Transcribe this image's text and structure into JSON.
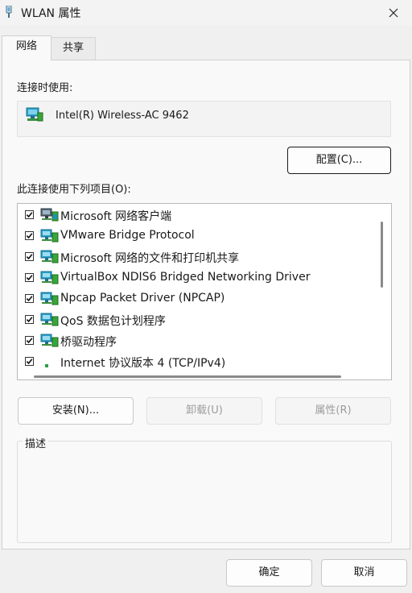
{
  "window": {
    "title": "WLAN 属性",
    "title_icon": "network-adapter-icon",
    "close_icon": "close-icon"
  },
  "tabs": [
    {
      "label": "网络",
      "selected": true
    },
    {
      "label": "共享",
      "selected": false
    }
  ],
  "connect_using": {
    "label": "连接时使用:",
    "adapter_name": "Intel(R) Wireless-AC 9462",
    "adapter_icon": "network-adapter-icon",
    "configure_button": "配置(C)..."
  },
  "items_label": "此连接使用下列项目(O):",
  "items": [
    {
      "label": "Microsoft 网络客户端",
      "checked": true,
      "icon": "network-client-icon"
    },
    {
      "label": "VMware Bridge Protocol",
      "checked": true,
      "icon": "network-service-icon"
    },
    {
      "label": "Microsoft 网络的文件和打印机共享",
      "checked": true,
      "icon": "network-service-icon"
    },
    {
      "label": "VirtualBox NDIS6 Bridged Networking Driver",
      "checked": true,
      "icon": "network-service-icon"
    },
    {
      "label": "Npcap Packet Driver (NPCAP)",
      "checked": true,
      "icon": "network-service-icon"
    },
    {
      "label": "QoS 数据包计划程序",
      "checked": true,
      "icon": "network-service-icon"
    },
    {
      "label": "桥驱动程序",
      "checked": true,
      "icon": "network-service-icon"
    },
    {
      "label": "Internet 协议版本 4 (TCP/IPv4)",
      "checked": true,
      "icon": "protocol-icon"
    }
  ],
  "action_buttons": {
    "install": "安装(N)...",
    "uninstall": "卸载(U)",
    "properties": "属性(R)"
  },
  "description": {
    "label": "描述",
    "text": ""
  },
  "footer": {
    "ok": "确定",
    "cancel": "取消"
  },
  "colors": {
    "window_bg": "#f0f0f0",
    "panel_bg": "#f9f9f9",
    "list_bg": "#ffffff",
    "border": "#d0d0d0",
    "adapter_icon": "#2aa0c8"
  }
}
